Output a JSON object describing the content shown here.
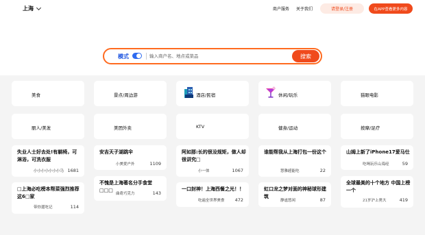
{
  "header": {
    "city": "上海",
    "links": [
      "商户服务",
      "关于我们"
    ],
    "login_button": "请登录/注册",
    "app_button": "在APP查看更多内容"
  },
  "search": {
    "mode_label": "模式",
    "placeholder": "输入商户名、地点或菜品",
    "button": "搜索"
  },
  "categories": [
    {
      "label": "美食"
    },
    {
      "label": "景点/周边游"
    },
    {
      "label": "酒店/民宿",
      "icon": "hotel-building-icon"
    },
    {
      "label": "休闲/玩乐",
      "icon": "cocktail-icon"
    },
    {
      "label": "猫眼电影"
    },
    {
      "label": "丽人/美发"
    },
    {
      "label": "美团外卖"
    },
    {
      "label": "KTV"
    },
    {
      "label": "健身/运动"
    },
    {
      "label": "按摩/足疗"
    }
  ],
  "posts": [
    {
      "title": "失业人士好去处!有躺椅，可淋浴，可洗衣服",
      "author": "小小小小小小小马",
      "count": "1681"
    },
    {
      "title": "□上海必吃榜本帮菜强烈推荐这6□家",
      "author": "带你遛吃记",
      "count": "114"
    },
    {
      "title": "安吉天子湖跳伞",
      "author": "小美爱户外",
      "count": "1109"
    },
    {
      "title": "不愧是上海著名分手食堂□□□",
      "author": "曲奇巧克力",
      "count": "143"
    },
    {
      "title": "阿如那:长的很没规矩，做人却很讲究□",
      "author": "小一体",
      "count": "1067"
    },
    {
      "title": "一口封神！上海西餐之光！！",
      "author": "吃遍全世界美食",
      "count": "472"
    },
    {
      "title": "谁能帮我从上海打包一份这个",
      "author": "慧雅超能吃",
      "count": "22"
    },
    {
      "title": "虹口龙之梦对面的神秘球形建筑",
      "author": "静谧悠闲",
      "count": "87"
    },
    {
      "title": "山姆上新了iPhone17爱马仕",
      "author": "吃喝玩乐山海经",
      "count": "59"
    },
    {
      "title": "全球最美的十个地方 中国上榜一个",
      "author": "21岁沪上男大",
      "count": "419"
    }
  ],
  "colors": {
    "accent": "#f04a1c",
    "mode_blue": "#1f56e0",
    "panel_bg": "#f4f4f4"
  }
}
